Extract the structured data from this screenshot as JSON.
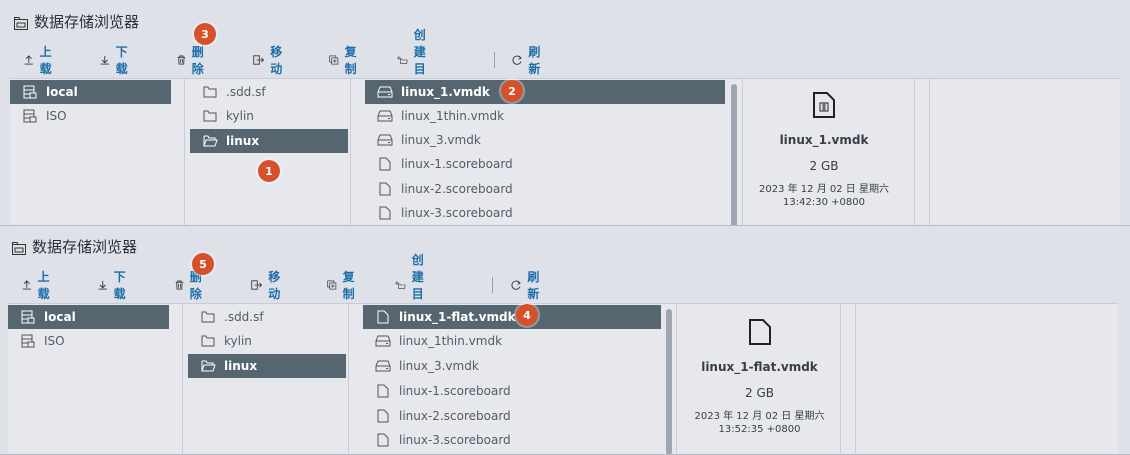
{
  "panel1": {
    "title": "数据存储浏览器",
    "toolbar": {
      "upload": "上载",
      "download": "下载",
      "delete": "删除",
      "move": "移动",
      "copy": "复制",
      "create_dir": "创建目录",
      "refresh": "刷新"
    },
    "datastores": [
      "local",
      "ISO"
    ],
    "folders": [
      ".sdd.sf",
      "kylin",
      "linux"
    ],
    "files": [
      "linux_1.vmdk",
      "linux_1thin.vmdk",
      "linux_3.vmdk",
      "linux-1.scoreboard",
      "linux-2.scoreboard",
      "linux-3.scoreboard"
    ],
    "detail": {
      "name": "linux_1.vmdk",
      "size": "2 GB",
      "date": "2023 年 12 月 02 日 星期六",
      "time": "13:42:30 +0800"
    },
    "badges": {
      "b1": "1",
      "b2": "2",
      "b3": "3"
    }
  },
  "panel2": {
    "title": "数据存储浏览器",
    "toolbar": {
      "upload": "上载",
      "download": "下载",
      "delete": "删除",
      "move": "移动",
      "copy": "复制",
      "create_dir": "创建目录",
      "refresh": "刷新"
    },
    "datastores": [
      "local",
      "ISO"
    ],
    "folders": [
      ".sdd.sf",
      "kylin",
      "linux"
    ],
    "files": [
      "linux_1-flat.vmdk",
      "linux_1thin.vmdk",
      "linux_3.vmdk",
      "linux-1.scoreboard",
      "linux-2.scoreboard",
      "linux-3.scoreboard"
    ],
    "detail": {
      "name": "linux_1-flat.vmdk",
      "size": "2 GB",
      "date": "2023 年 12 月 02 日 星期六",
      "time": "13:52:35 +0800"
    },
    "badges": {
      "b4": "4",
      "b5": "5"
    }
  },
  "colors": {
    "accent": "#1c6fa8",
    "selected_row": "#566670",
    "badge": "#d6502c"
  },
  "icons": {
    "title": "datastore-browser-icon",
    "upload": "upload-arrow-icon",
    "download": "download-arrow-icon",
    "delete": "trash-icon",
    "move": "move-icon",
    "copy": "copy-icon",
    "create_dir": "new-folder-icon",
    "refresh": "refresh-icon",
    "datastore": "datastore-icon",
    "folder": "folder-icon",
    "disk": "disk-icon",
    "file": "file-icon",
    "vmdk_file": "vmdk-file-icon"
  }
}
